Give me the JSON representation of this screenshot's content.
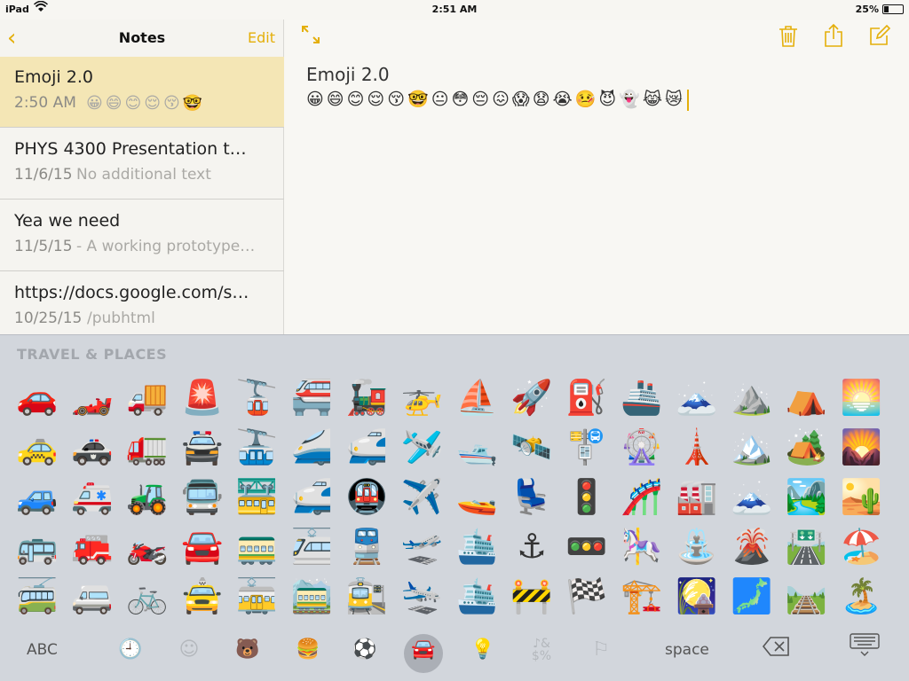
{
  "status_bar": {
    "device": "iPad",
    "time": "2:51 AM",
    "battery": "25%"
  },
  "sidebar": {
    "title": "Notes",
    "edit_label": "Edit",
    "back_icon": "chevron-left-icon",
    "notes": [
      {
        "title": "Emoji 2.0",
        "date": "2:50 AM",
        "preview": "😀😄😊😌😚🤓"
      },
      {
        "title": "PHYS 4300 Presentation t…",
        "date": "11/6/15",
        "preview": "No additional text"
      },
      {
        "title": "Yea we need",
        "date": "11/5/15",
        "preview": "- A working prototype…"
      },
      {
        "title": "https://docs.google.com/s…",
        "date": "10/25/15",
        "preview": "/pubhtml"
      }
    ]
  },
  "note": {
    "title": "Emoji 2.0",
    "body": "😀😄😊😌😚🤓😐😳😔😖😱😧😭🤒😈👻😹😿"
  },
  "keyboard": {
    "category_label": "TRAVEL & PLACES",
    "rows": [
      [
        "🚗",
        "🏎️",
        "🚚",
        "🚨",
        "🚡",
        "🚝",
        "🚂",
        "🚁",
        "⛵",
        "🚀",
        "⛽",
        "🚢",
        "🗻",
        "⛰️",
        "⛺",
        "🌅"
      ],
      [
        "🚕",
        "🚓",
        "🚛",
        "🚔",
        "🚠",
        "🚄",
        "🚅",
        "🛩️",
        "🛥️",
        "🛰️",
        "🚏",
        "🎡",
        "🗼",
        "🏔️",
        "🏕️",
        "🌄"
      ],
      [
        "🚙",
        "🚑",
        "🚜",
        "🚍",
        "🚟",
        "🚅",
        "🚇",
        "✈️",
        "🚤",
        "💺",
        "🚦",
        "🎢",
        "🏭",
        "🗻",
        "🏞️",
        "🏜️"
      ],
      [
        "🚌",
        "🚒",
        "🏍️",
        "🚘",
        "🚃",
        "🚈",
        "🚆",
        "🛫",
        "🛳️",
        "⚓",
        "🚥",
        "🎠",
        "⛲",
        "🌋",
        "🛣️",
        "🏖️"
      ],
      [
        "🚎",
        "🚐",
        "🚲",
        "🚖",
        "🚋",
        "🚞",
        "🚉",
        "🛬",
        "🛳️",
        "🚧",
        "🏁",
        "🏗️",
        "🎑",
        "🗾",
        "🛤️",
        "🏝️"
      ]
    ],
    "abc_label": "ABC",
    "space_label": "space",
    "category_icons": [
      "clock-icon",
      "smiley-icon",
      "bear-icon",
      "food-icon",
      "ball-icon",
      "car-icon",
      "bulb-icon",
      "symbols-icon",
      "flag-icon"
    ]
  }
}
